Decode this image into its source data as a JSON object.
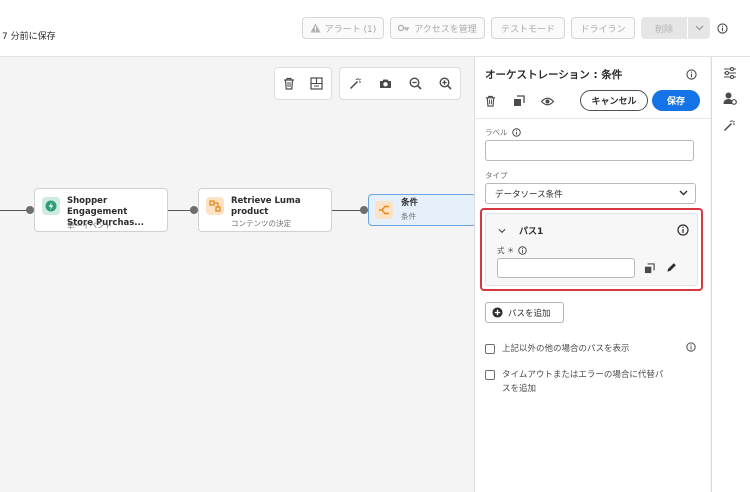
{
  "header": {
    "saved_status": "7 分前に保存",
    "alerts_label": "アラート (1)",
    "access_label": "アクセスを管理",
    "test_mode_label": "テストモード",
    "dry_run_label": "ドライラン",
    "delete_label": "削除"
  },
  "nodes": [
    {
      "title_line1": "Shopper Engagement",
      "title_line2": "Store Purchas...",
      "subtitle": "単一イベント",
      "icon": "event-icon",
      "color": "#2d9d78"
    },
    {
      "title_line1": "Retrieve Luma",
      "title_line2": "product",
      "subtitle": "コンテンツの決定",
      "icon": "decision-icon",
      "color": "#e68619"
    },
    {
      "title_line1": "条件",
      "title_line2": "",
      "subtitle": "条件",
      "icon": "condition-icon",
      "color": "#e68619"
    }
  ],
  "panel": {
    "title": "オーケストレーション : 条件",
    "cancel_label": "キャンセル",
    "save_label": "保存",
    "label_field_label": "ラベル",
    "label_value": "",
    "type_label": "タイプ",
    "type_value": "データソース条件",
    "path": {
      "name": "パス1",
      "expression_label": "式 ＊",
      "expression_value": ""
    },
    "add_path_label": "パスを追加",
    "checkbox_other_label": "上記以外の他の場合のパスを表示",
    "checkbox_timeout_line1": "タイムアウトまたはエラーの場合に代替パ",
    "checkbox_timeout_line2": "スを追加",
    "checkbox_other_checked": false,
    "checkbox_timeout_checked": false
  },
  "colors": {
    "accent": "#1473e6",
    "highlight_border": "#d7373f",
    "selected_node_bg": "#e5f0fb"
  }
}
